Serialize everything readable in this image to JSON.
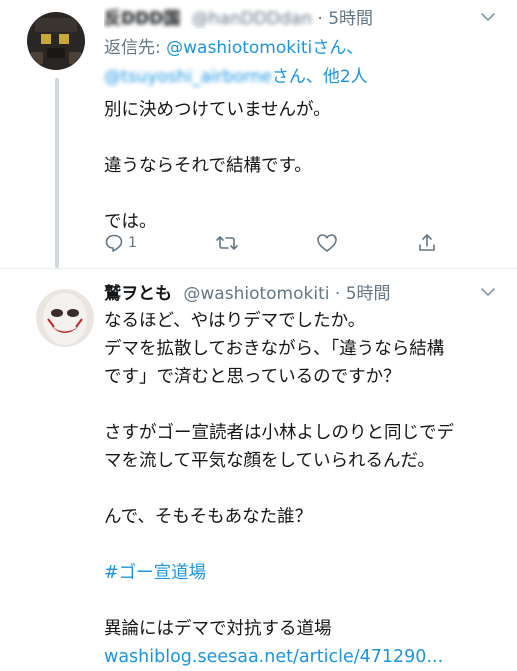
{
  "tweet1": {
    "name": "反DDD国",
    "handle": "@hanDDDdan",
    "dot": "·",
    "time": "5時間",
    "reply_prefix": "返信先: ",
    "reply_user1": "@washiotomokiti",
    "reply_san1": "さん、",
    "reply_user2": "@tsuyoshi_airborne",
    "reply_san2": "さん、",
    "reply_others": "他2人",
    "lines": [
      "別に決めつけていませんが。",
      "違うならそれで結構です。",
      "では。"
    ],
    "reply_count": "1",
    "icons": {
      "reply": "reply-icon",
      "retweet": "retweet-icon",
      "like": "heart-icon",
      "share": "share-icon"
    }
  },
  "tweet2": {
    "name": "鷲ヲとも",
    "handle": "@washiotomokiti",
    "dot": "·",
    "time": "5時間",
    "para1": [
      "なるほど、やはりデマでしたか。",
      "デマを拡散しておきながら、「違うなら結構",
      "です」で済むと思っているのですか？"
    ],
    "para2": [
      "さすがゴー宣読者は小林よしのりと同じでデ",
      "マを流して平気な顔をしていられるんだ。"
    ],
    "para3": "んで、そもそもあなた誰？",
    "hashtag": "#ゴー宣道場",
    "para4": "異論にはデマで対抗する道場",
    "url": "washiblog.seesaa.net/article/471290..."
  },
  "colors": {
    "link": "#1b95e0",
    "muted": "#657786",
    "text": "#14171a",
    "thread_line": "#cfd9de"
  }
}
